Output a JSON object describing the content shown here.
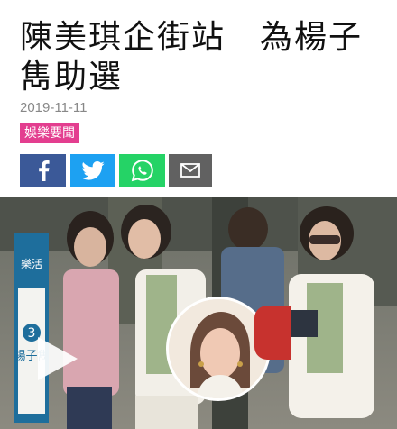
{
  "article": {
    "title": "陳美琪企街站　為楊子雋助選",
    "date": "2019-11-11",
    "category": "娛樂要聞"
  },
  "share": [
    {
      "name": "facebook-icon",
      "color": "#3b5998"
    },
    {
      "name": "twitter-icon",
      "color": "#1da1f2"
    },
    {
      "name": "whatsapp-icon",
      "color": "#25d366"
    },
    {
      "name": "email-icon",
      "color": "#616161"
    }
  ],
  "photo": {
    "banner_text": [
      "樂活",
      "楊子雋"
    ],
    "banner_number": "3"
  },
  "colors": {
    "category_badge": "#e33e8f"
  }
}
